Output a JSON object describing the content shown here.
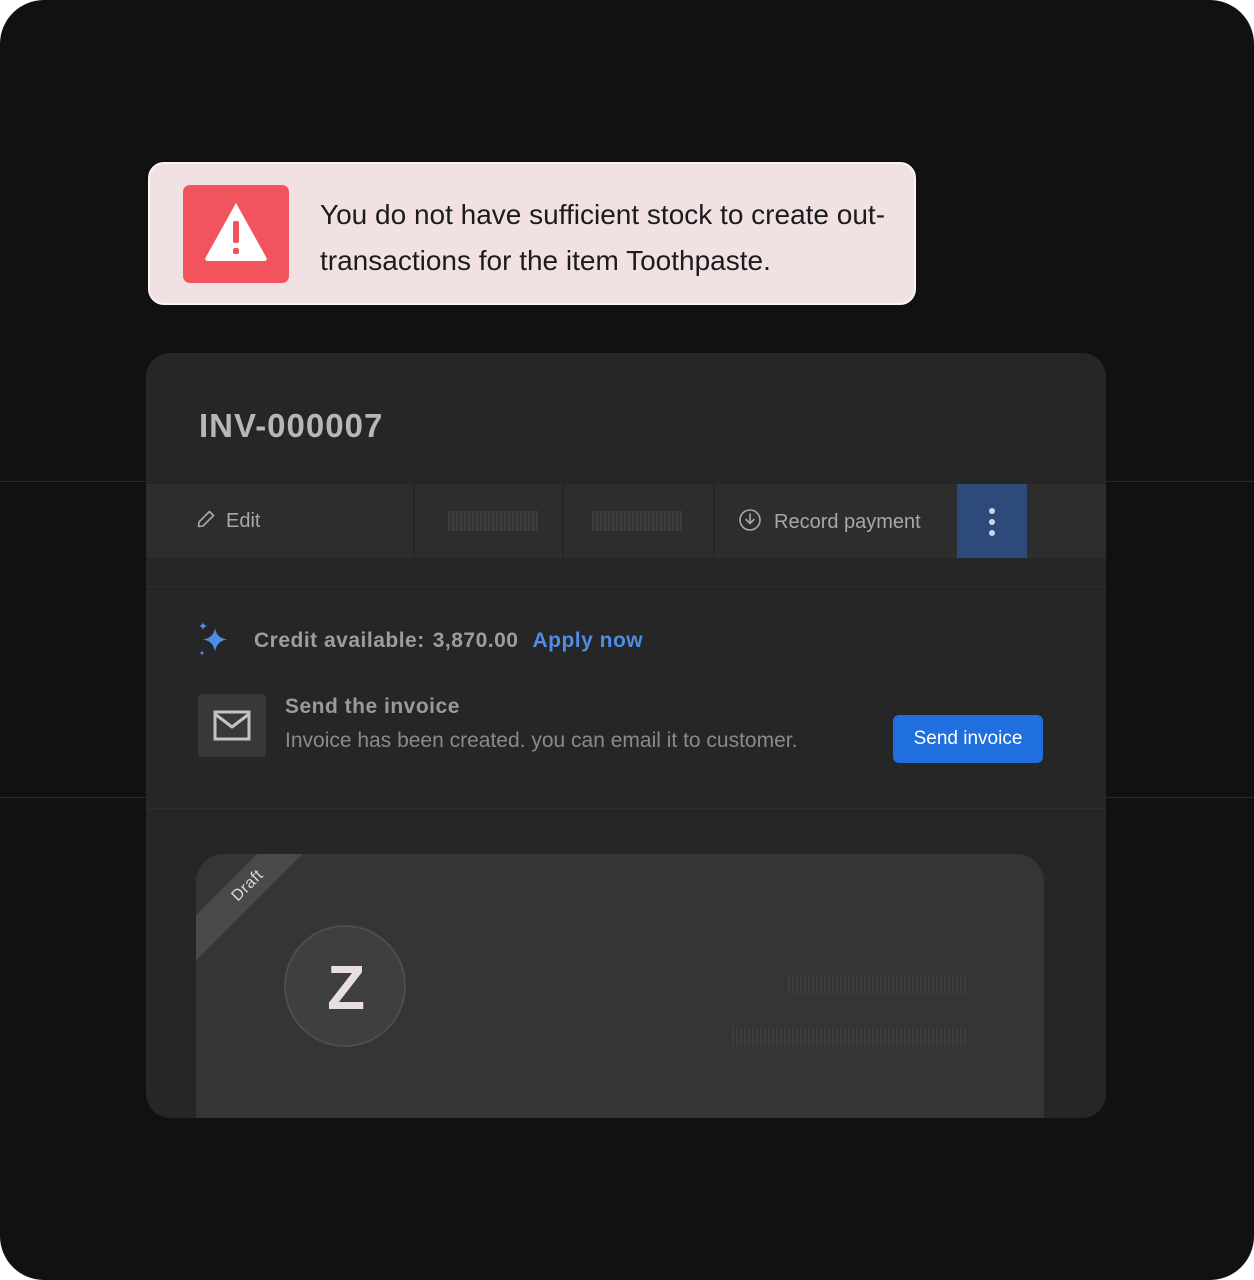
{
  "alert": {
    "icon": "warning-triangle-icon",
    "message": "You do not have sufficient stock to create out-transactions for the item Toothpaste.",
    "colors": {
      "background": "#f1e1e3",
      "icon_background": "#f2545e"
    }
  },
  "invoice": {
    "number": "INV-000007",
    "toolbar": {
      "edit_label": "Edit",
      "edit_icon": "pencil-icon",
      "record_payment_label": "Record payment",
      "record_payment_icon": "download-circle-icon",
      "more_icon": "vertical-ellipsis-icon"
    },
    "credit": {
      "icon": "sparkle-icon",
      "label": "Credit available:",
      "amount": "3,870.00",
      "apply_label": "Apply now"
    },
    "send": {
      "icon": "mail-icon",
      "title": "Send the invoice",
      "subtitle": "Invoice has been created. you can email it to customer.",
      "button_label": "Send invoice"
    },
    "preview": {
      "status_ribbon": "Draft",
      "logo_letter": "Z"
    }
  },
  "colors": {
    "accent": "#1f6fde",
    "link": "#4d8de6",
    "page_background": "#111111",
    "panel_background": "#262626"
  }
}
